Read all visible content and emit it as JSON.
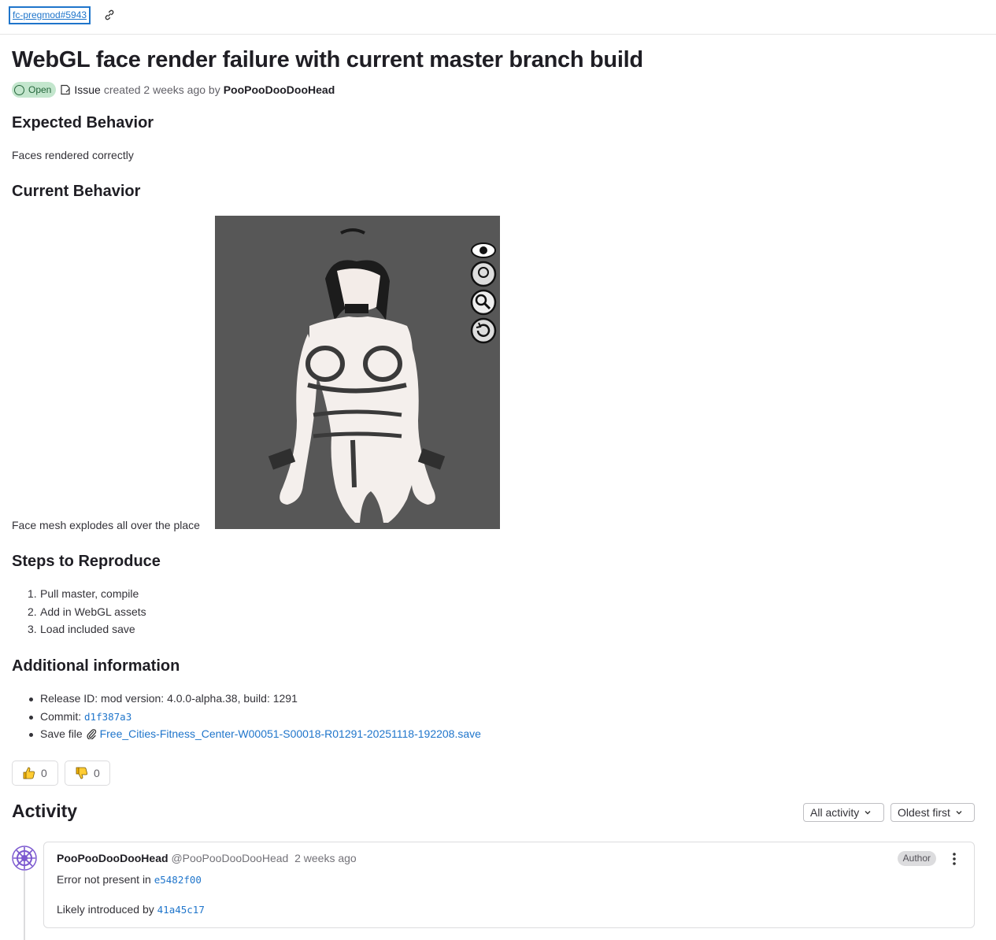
{
  "breadcrumb": {
    "issue_ref": "fc-pregmod#5943"
  },
  "issue": {
    "title": "WebGL face render failure with current master branch build",
    "status": "Open",
    "type": "Issue",
    "created_text": "created 2 weeks ago by",
    "author": "PooPooDooDooHead"
  },
  "sections": {
    "expected_heading": "Expected Behavior",
    "expected_text": "Faces rendered correctly",
    "current_heading": "Current Behavior",
    "current_text": "Face mesh explodes all over the place",
    "steps_heading": "Steps to Reproduce",
    "steps": [
      {
        "num": "1.",
        "text": "Pull master, compile"
      },
      {
        "num": "2.",
        "text": "Add in WebGL assets"
      },
      {
        "num": "3.",
        "text": "Load included save"
      }
    ],
    "info_heading": "Additional information",
    "info_release": "Release ID: mod version: 4.0.0-alpha.38, build: 1291",
    "info_commit_label": "Commit:",
    "info_commit_hash": "d1f387a3",
    "info_save_label": "Save file",
    "info_save_file": "Free_Cities-Fitness_Center-W00051-S00018-R01291-20251118-192208.save"
  },
  "reactions": {
    "thumbs_up_count": "0",
    "thumbs_down_count": "0"
  },
  "activity": {
    "heading": "Activity",
    "filter": "All activity",
    "sort": "Oldest first"
  },
  "note": {
    "author_name": "PooPooDooDooHead",
    "author_handle": "@PooPooDooDooHead",
    "time": "2 weeks ago",
    "badge": "Author",
    "line1_prefix": "Error not present in",
    "line1_hash": "e5482f00",
    "line2_prefix": "Likely introduced by",
    "line2_hash": "41a45c17"
  },
  "icons": {
    "link": "link-icon",
    "issue_type": "issue-type-icon",
    "paperclip": "paperclip-icon",
    "thumbs_up": "thumbs-up-icon",
    "thumbs_down": "thumbs-down-icon",
    "chevron": "chevron-down-icon",
    "kebab": "kebab-menu-icon",
    "render_controls": [
      "eye-icon",
      "face-icon",
      "zoom-icon",
      "reset-icon"
    ]
  },
  "colors": {
    "link": "#1f75cb",
    "open_badge_bg": "#c3e6cd",
    "open_badge_fg": "#24663b",
    "render_bg": "#575757"
  }
}
